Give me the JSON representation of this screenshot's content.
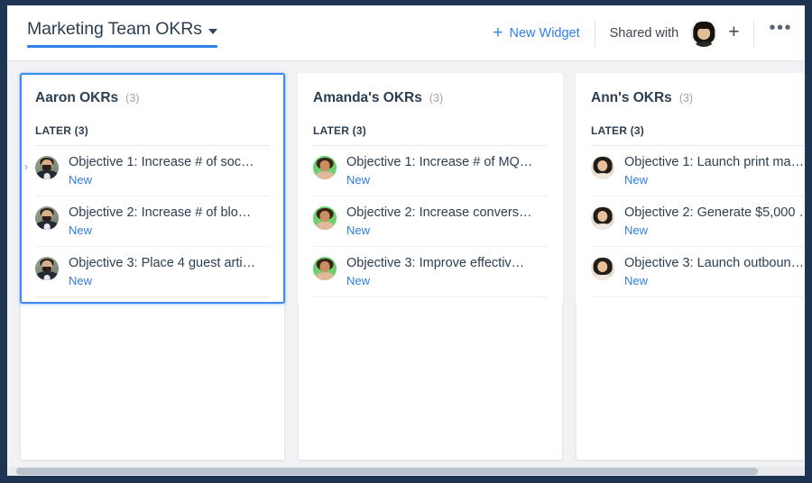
{
  "header": {
    "page_title": "Marketing Team OKRs",
    "dropdown_icon": "caret-down-icon",
    "new_widget_label": "New Widget",
    "new_widget_icon": "plus-icon",
    "new_widget_color": "#2f80ed",
    "shared_with_label": "Shared with",
    "shared_avatar_icon": "avatar-shared-user",
    "add_person_icon": "plus-icon",
    "overflow_icon": "ellipsis-icon",
    "overflow_label": "•••",
    "add_person_label": "+",
    "title_underline_color": "#2f80ed"
  },
  "board": {
    "columns": [
      {
        "title": "Aaron OKRs",
        "count": "(3)",
        "selected": true,
        "avatar_style": "av-aaron",
        "section": {
          "label": "LATER (3)"
        },
        "rows": [
          {
            "title": "Objective 1: Increase # of soc…",
            "status": "New",
            "chevron": "›"
          },
          {
            "title": "Objective 2: Increase # of blo…",
            "status": "New"
          },
          {
            "title": "Objective 3: Place 4 guest arti…",
            "status": "New"
          }
        ]
      },
      {
        "title": "Amanda's OKRs",
        "count": "(3)",
        "selected": false,
        "avatar_style": "av-amanda",
        "section": {
          "label": "LATER (3)"
        },
        "rows": [
          {
            "title": "Objective 1: Increase # of MQ…",
            "status": "New"
          },
          {
            "title": "Objective 2: Increase convers…",
            "status": "New"
          },
          {
            "title": "Objective 3: Improve effectiv…",
            "status": "New"
          }
        ]
      },
      {
        "title": "Ann's OKRs",
        "count": "(3)",
        "selected": false,
        "avatar_style": "av-ann",
        "section": {
          "label": "LATER (3)"
        },
        "rows": [
          {
            "title": "Objective 1: Launch print ma…",
            "status": "New"
          },
          {
            "title": "Objective 2: Generate $5,000 …",
            "status": "New"
          },
          {
            "title": "Objective 3: Launch outboun…",
            "status": "New"
          }
        ]
      }
    ]
  },
  "scrollbar": {
    "orientation": "horizontal"
  },
  "colors": {
    "frame": "#1d3552",
    "accent": "#2f80ed",
    "link": "#2f7fd6",
    "text": "#2c3e50",
    "muted": "#9aa3ad"
  }
}
